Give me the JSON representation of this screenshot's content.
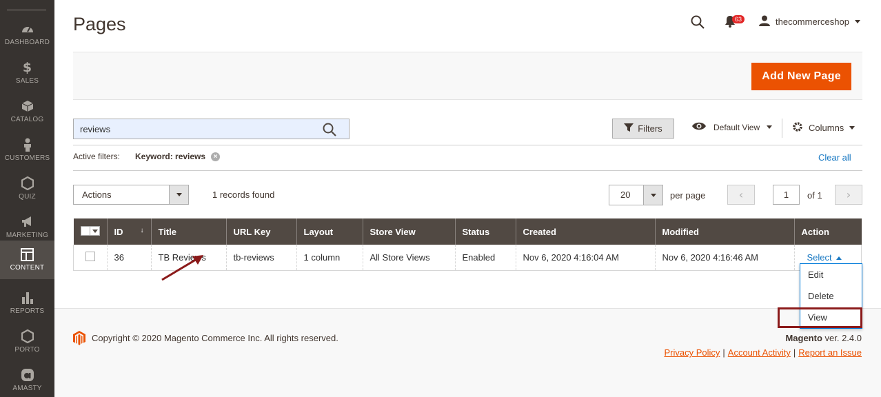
{
  "sidebar": {
    "items": [
      {
        "label": "DASHBOARD",
        "icon": "dashboard-icon"
      },
      {
        "label": "SALES",
        "icon": "dollar-icon"
      },
      {
        "label": "CATALOG",
        "icon": "box-icon"
      },
      {
        "label": "CUSTOMERS",
        "icon": "person-icon"
      },
      {
        "label": "QUIZ",
        "icon": "hexagon-icon"
      },
      {
        "label": "MARKETING",
        "icon": "megaphone-icon"
      },
      {
        "label": "CONTENT",
        "icon": "layout-icon",
        "active": true
      },
      {
        "label": "REPORTS",
        "icon": "bar-chart-icon"
      },
      {
        "label": "PORTO",
        "icon": "hexagon-icon"
      },
      {
        "label": "AMASTY",
        "icon": "amasty-logo-icon"
      }
    ]
  },
  "header": {
    "title": "Pages",
    "notifications_count": "63",
    "username": "thecommerceshop"
  },
  "toolbar": {
    "add_button": "Add New Page"
  },
  "search": {
    "value": "reviews"
  },
  "grid_controls": {
    "filters_label": "Filters",
    "view_label": "Default View",
    "columns_label": "Columns",
    "active_filters_label": "Active filters:",
    "active_filter_keyword": "Keyword: reviews",
    "clear_all": "Clear all",
    "actions_label": "Actions",
    "records_found": "1 records found",
    "per_page_value": "20",
    "per_page_label": "per page",
    "current_page": "1",
    "total_pages": "of 1"
  },
  "table": {
    "columns": [
      "ID",
      "Title",
      "URL Key",
      "Layout",
      "Store View",
      "Status",
      "Created",
      "Modified",
      "Action"
    ],
    "rows": [
      {
        "id": "36",
        "title": "TB Reviews",
        "url_key": "tb-reviews",
        "layout": "1 column",
        "store_view": "All Store Views",
        "status": "Enabled",
        "created": "Nov 6, 2020 4:16:04 AM",
        "modified": "Nov 6, 2020 4:16:46 AM",
        "action": "Select"
      }
    ]
  },
  "action_menu": {
    "items": [
      "Edit",
      "Delete",
      "View"
    ]
  },
  "footer": {
    "copyright": "Copyright © 2020 Magento Commerce Inc. All rights reserved.",
    "brand": "Magento",
    "version": "ver. 2.4.0",
    "links": [
      "Privacy Policy",
      "Account Activity",
      "Report an Issue"
    ]
  },
  "colors": {
    "accent": "#eb5202",
    "sidebar_bg": "#373330",
    "table_header_bg": "#514943",
    "link": "#1979c3",
    "annotation": "#8b1a1a"
  }
}
